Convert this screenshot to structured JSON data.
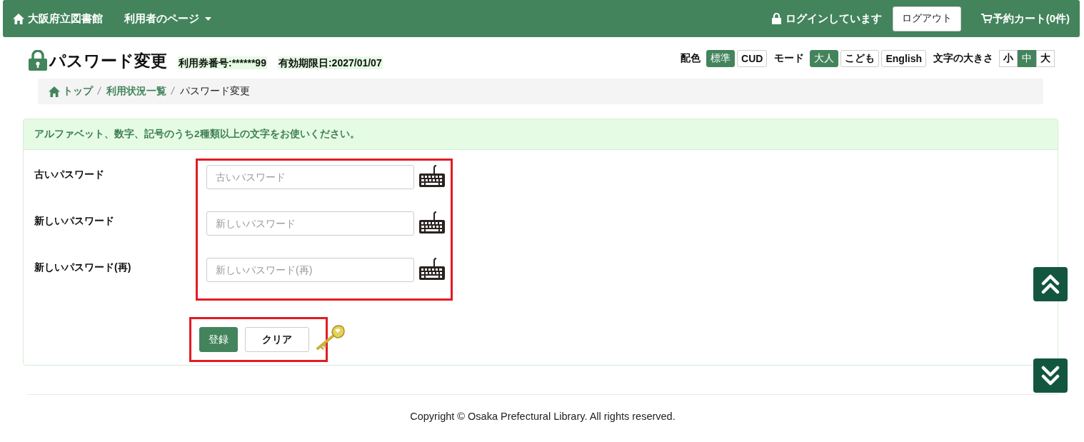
{
  "navbar": {
    "brand": "大阪府立図書館",
    "user_menu": "利用者のページ",
    "login_status": "ログインしています",
    "logout": "ログアウト",
    "cart": "予約カート(0件)"
  },
  "page": {
    "title": "パスワード変更",
    "card_number": "利用券番号:******99",
    "expiry": "有効期限日:2027/01/07"
  },
  "options": [
    {
      "label": "配色",
      "buttons": [
        {
          "label": "標準",
          "selected": true
        },
        {
          "label": "CUD",
          "selected": false
        }
      ]
    },
    {
      "label": "モード",
      "buttons": [
        {
          "label": "大人",
          "selected": true
        },
        {
          "label": "こども",
          "selected": false
        },
        {
          "label": "English",
          "selected": false
        }
      ]
    },
    {
      "label": "文字の大きさ",
      "buttons": [
        {
          "label": "小",
          "selected": false
        },
        {
          "label": "中",
          "selected": true
        },
        {
          "label": "大",
          "selected": false
        }
      ]
    }
  ],
  "breadcrumb": [
    {
      "label": "トップ",
      "kind": "home"
    },
    {
      "label": "利用状況一覧",
      "kind": "link"
    },
    {
      "label": "パスワード変更",
      "kind": "current"
    }
  ],
  "notice": "アルファベット、数字、記号のうち2種類以上の文字をお使いください。",
  "fields": [
    {
      "label": "古いパスワード",
      "placeholder": "古いパスワード"
    },
    {
      "label": "新しいパスワード",
      "placeholder": "新しいパスワード"
    },
    {
      "label": "新しいパスワード(再)",
      "placeholder": "新しいパスワード(再)"
    }
  ],
  "buttons": [
    {
      "label": "登録",
      "kind": "primary"
    },
    {
      "label": "クリア",
      "kind": "default"
    }
  ],
  "footer": "Copyright © Osaka Prefectural Library. All rights reserved."
}
